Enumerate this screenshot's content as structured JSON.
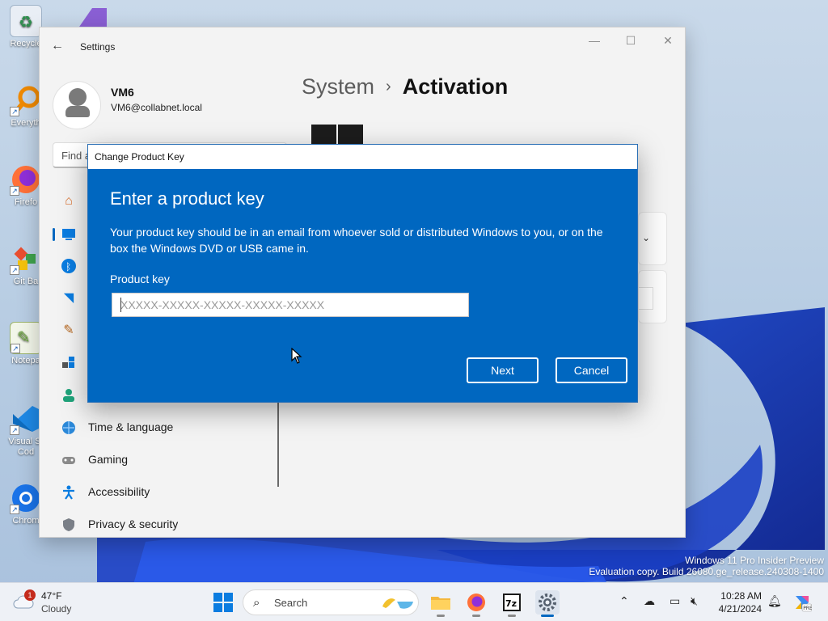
{
  "desktop": {
    "icons": [
      {
        "label": "Recycle",
        "icon": "recycle-bin-icon"
      },
      {
        "label": "Everyth",
        "icon": "everything-search-icon"
      },
      {
        "label": "Firefo",
        "icon": "firefox-icon"
      },
      {
        "label": "Git Ba",
        "icon": "git-bash-icon"
      },
      {
        "label": "Notepa",
        "icon": "notepad-plus-plus-icon"
      },
      {
        "label": "Visual St Cod",
        "icon": "vscode-icon"
      },
      {
        "label": "Chrom",
        "icon": "chrome-icon"
      }
    ]
  },
  "settings": {
    "title": "Settings",
    "user": {
      "name": "VM6",
      "email": "VM6@collabnet.local"
    },
    "find_placeholder": "Find a",
    "breadcrumb": {
      "parent": "System",
      "separator": "›",
      "current": "Activation"
    },
    "nav": [
      {
        "label": "",
        "icon": "home-icon"
      },
      {
        "label": "",
        "icon": "system-icon",
        "active": true
      },
      {
        "label": "",
        "icon": "bluetooth-icon"
      },
      {
        "label": "",
        "icon": "wifi-icon"
      },
      {
        "label": "",
        "icon": "paintbrush-icon"
      },
      {
        "label": "",
        "icon": "apps-icon"
      },
      {
        "label": "",
        "icon": "accounts-icon"
      },
      {
        "label": "Time & language",
        "icon": "globe-clock-icon"
      },
      {
        "label": "Gaming",
        "icon": "gamepad-icon"
      },
      {
        "label": "Accessibility",
        "icon": "accessibility-icon"
      },
      {
        "label": "Privacy & security",
        "icon": "shield-icon"
      }
    ]
  },
  "dialog": {
    "title": "Change Product Key",
    "heading": "Enter a product key",
    "description": "Your product key should be in an email from whoever sold or distributed Windows to you, or on the box the Windows DVD or USB came in.",
    "field_label": "Product key",
    "field_placeholder": "XXXXX-XXXXX-XXXXX-XXXXX-XXXXX",
    "field_value": "",
    "next_label": "Next",
    "cancel_label": "Cancel"
  },
  "watermark": {
    "line1": "Windows 11 Pro Insider Preview",
    "line2": "Evaluation copy. Build 26080.ge_release.240308-1400"
  },
  "taskbar": {
    "weather": {
      "temp": "47°F",
      "condition": "Cloudy",
      "badge": "1"
    },
    "search_label": "Search",
    "apps": [
      "file-explorer-icon",
      "firefox-icon",
      "7zip-icon",
      "settings-gear-icon"
    ],
    "clock": {
      "time": "10:28 AM",
      "date": "4/21/2024"
    }
  },
  "colors": {
    "accent": "#0067c0",
    "dialog_bg": "#0067c0"
  }
}
